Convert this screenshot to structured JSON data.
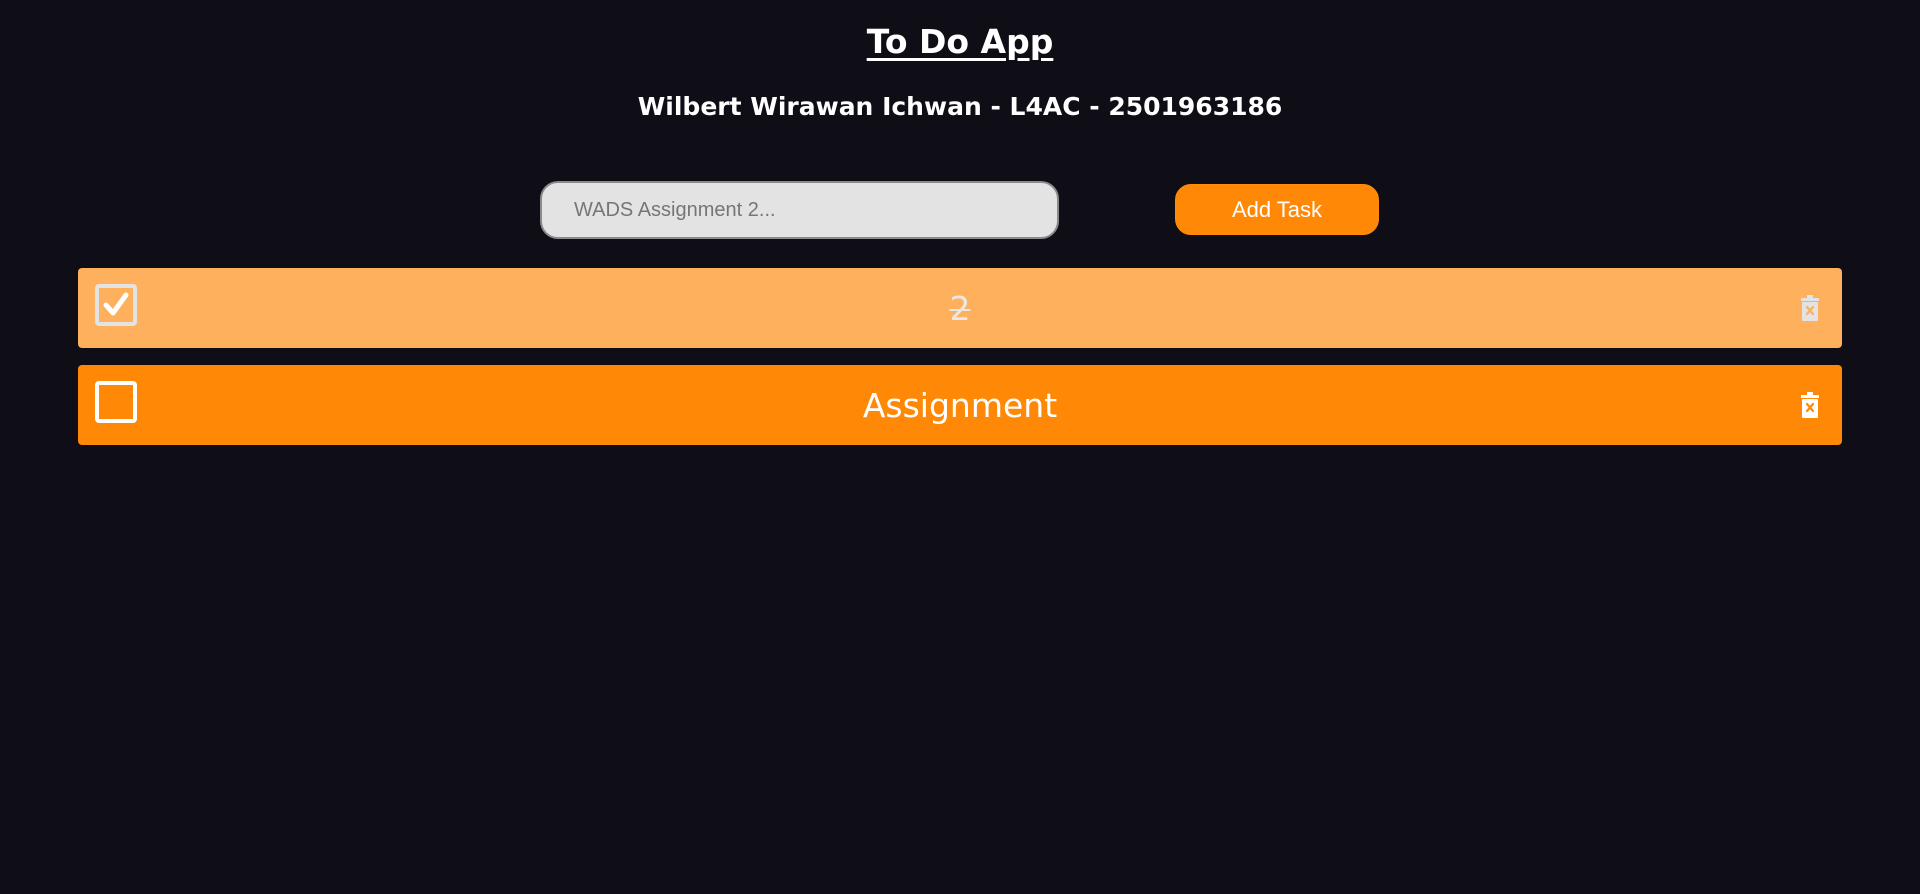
{
  "header": {
    "title": "To Do App",
    "subtitle": "Wilbert Wirawan Ichwan - L4AC - 2501963186"
  },
  "form": {
    "input_value": "",
    "input_placeholder": "WADS Assignment 2...",
    "add_button_label": "Add Task"
  },
  "tasks": [
    {
      "text": "2",
      "completed": true
    },
    {
      "text": "Assignment",
      "completed": false
    }
  ],
  "icons": {
    "checkbox_checked": "check-icon",
    "delete": "trash-icon"
  },
  "colors": {
    "background": "#0f0e17",
    "accent": "#ff8906",
    "completed_row": "#ffb05c",
    "input_bg": "#e3e3e3"
  }
}
